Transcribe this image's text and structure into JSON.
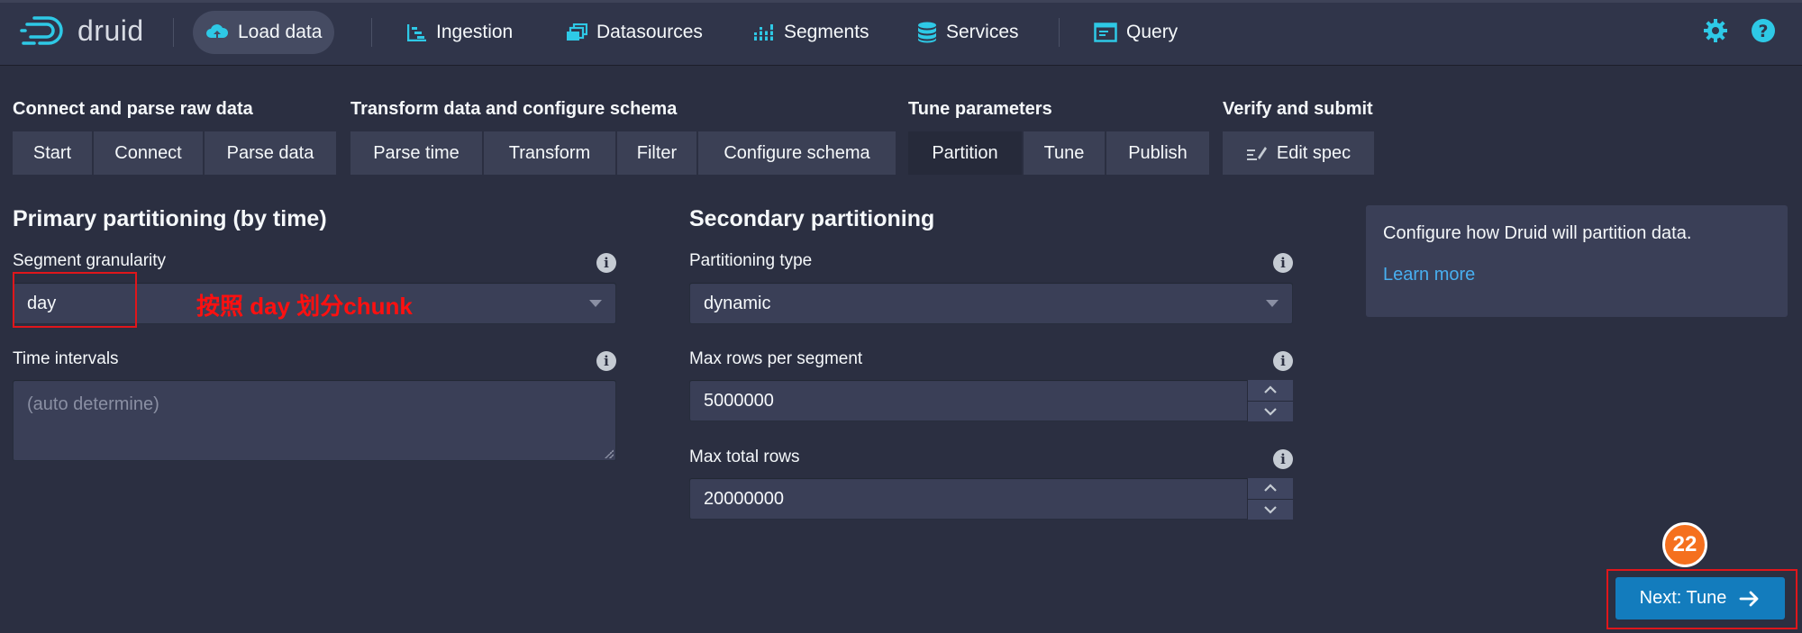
{
  "app": {
    "name": "druid"
  },
  "nav": {
    "load_data": "Load data",
    "ingestion": "Ingestion",
    "datasources": "Datasources",
    "segments": "Segments",
    "services": "Services",
    "query": "Query"
  },
  "steps": {
    "group1": {
      "title": "Connect and parse raw data",
      "items": [
        "Start",
        "Connect",
        "Parse data"
      ]
    },
    "group2": {
      "title": "Transform data and configure schema",
      "items": [
        "Parse time",
        "Transform",
        "Filter",
        "Configure schema"
      ]
    },
    "group3": {
      "title": "Tune parameters",
      "items": [
        "Partition",
        "Tune",
        "Publish"
      ],
      "active": "Partition"
    },
    "group4": {
      "title": "Verify and submit",
      "items": [
        "Edit spec"
      ]
    }
  },
  "primary": {
    "title": "Primary partitioning (by time)",
    "segment_granularity_label": "Segment granularity",
    "segment_granularity_value": "day",
    "time_intervals_label": "Time intervals",
    "time_intervals_placeholder": "(auto determine)"
  },
  "secondary": {
    "title": "Secondary partitioning",
    "partitioning_type_label": "Partitioning type",
    "partitioning_type_value": "dynamic",
    "max_rows_per_segment_label": "Max rows per segment",
    "max_rows_per_segment_value": "5000000",
    "max_total_rows_label": "Max total rows",
    "max_total_rows_value": "20000000"
  },
  "callout": {
    "text": "Configure how Druid will partition data.",
    "link": "Learn more"
  },
  "annotation": {
    "note": "按照 day 划分chunk",
    "badge": "22"
  },
  "footer": {
    "next_label": "Next: Tune"
  },
  "colors": {
    "background": "#2b2f41",
    "topbar": "#30354a",
    "accent_icon": "#15b4d5",
    "primary_button": "#137cbd",
    "link": "#48aff0",
    "annotation_red": "#e0161b",
    "badge_orange": "#f5701e"
  }
}
